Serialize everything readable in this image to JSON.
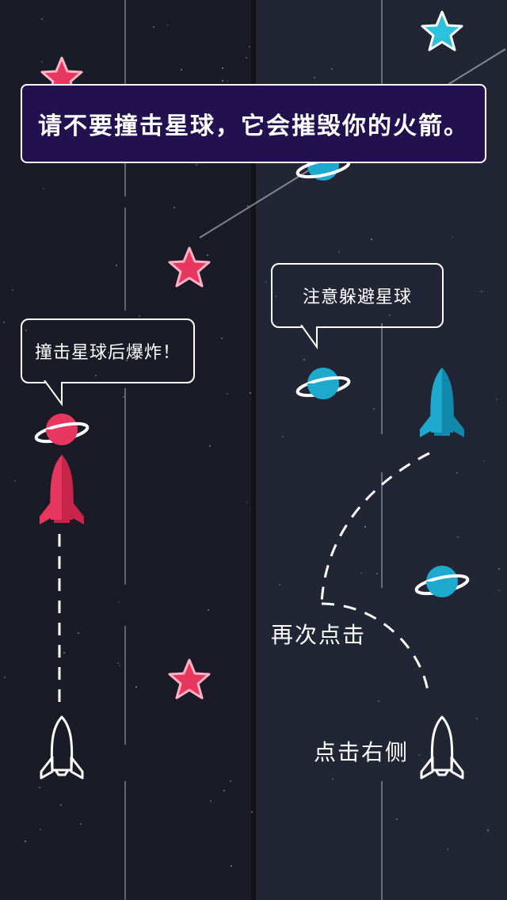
{
  "banner": {
    "text": "请不要撞击星球，它会摧毁你的火箭。"
  },
  "bubbles": {
    "crash": "撞击星球后爆炸！",
    "avoid": "注意躲避星球"
  },
  "hints": {
    "tap_right": "点击右侧",
    "tap_again": "再次点击"
  },
  "colors": {
    "left_bg": "#1b1b27",
    "right_bg": "#222533",
    "banner_bg": "#22104f",
    "pink": "#e8375f",
    "cyan": "#1ea9cf",
    "white": "#ffffff"
  },
  "icons": [
    "star-icon",
    "planet-icon",
    "rocket-icon",
    "rocket-outline-icon"
  ]
}
